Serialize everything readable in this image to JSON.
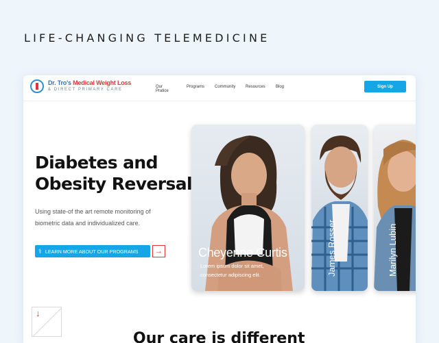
{
  "tagline": "LIFE-CHANGING TELEMEDICINE",
  "logo": {
    "name_part1": "Dr. Tro's",
    "name_part2": "Medical Weight Loss",
    "subtitle": "& DIRECT PRIMARY CARE"
  },
  "nav": {
    "items": [
      "Our Pratice",
      "Programs",
      "Community",
      "Resources",
      "Blog"
    ],
    "signup_label": "Sign Up"
  },
  "hero": {
    "title_line1": "Diabetes and",
    "title_line2": "Obesity Reversal",
    "subtitle": "Using state-of the art remote monitoring of biometric data and individualized care.",
    "cta_label": "LEARN MORE ABOUT OUR PROGRAMS",
    "cta_arrow": "→"
  },
  "cards": [
    {
      "name": "Cheyenne Curtis",
      "desc": "Lorem ipsum dolor sit amet, consectetur adipiscing elit."
    },
    {
      "name": "James Rosser"
    },
    {
      "name": "Marilyn Lubin"
    }
  ],
  "section": {
    "title": "Our care is different",
    "down_arrow": "↓"
  },
  "colors": {
    "accent": "#16a6e8",
    "red": "#e2323a",
    "background": "#eef5fb"
  },
  "icons": {
    "cta_icon": "stethoscope-icon",
    "logo_icon": "caduceus-icon"
  }
}
